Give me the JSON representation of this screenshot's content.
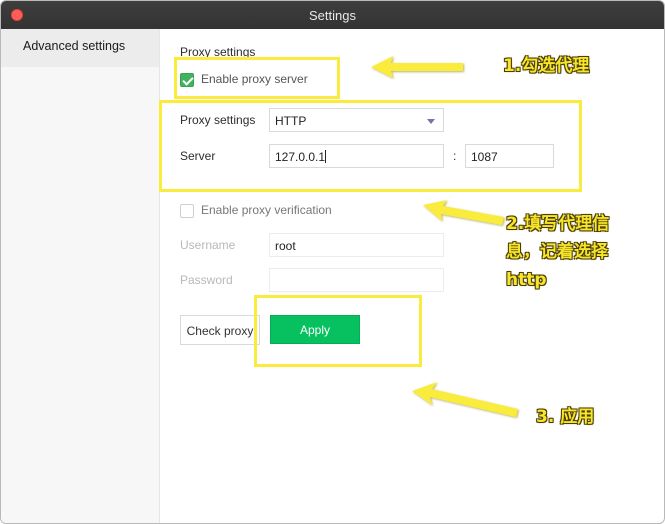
{
  "window": {
    "title": "Settings"
  },
  "sidebar": {
    "items": [
      {
        "label": "Advanced settings"
      }
    ]
  },
  "proxy": {
    "section_title": "Proxy settings",
    "enable_label": "Enable proxy server",
    "enable_checked": true,
    "type_label": "Proxy settings",
    "type_value": "HTTP",
    "server_label": "Server",
    "server_value": "127.0.0.1",
    "port_separator": ":",
    "port_value": "1087",
    "verification_label": "Enable proxy verification",
    "verification_checked": false,
    "username_label": "Username",
    "username_value": "root",
    "password_label": "Password",
    "password_value": "",
    "check_button": "Check proxy",
    "apply_button": "Apply"
  },
  "annotations": {
    "step1": "1.勾选代理",
    "step2_line1": "2.填写代理信",
    "step2_line2": "息，记着选择",
    "step2_line3": "http",
    "step3": "3. 应用",
    "highlight_color": "#f9ec3d"
  }
}
